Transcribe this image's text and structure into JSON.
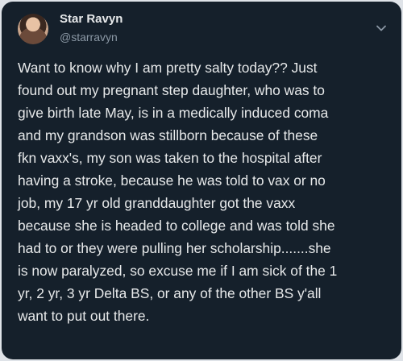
{
  "author": {
    "display_name": "Star Ravyn",
    "handle": "@starravyn",
    "avatar_icon": "profile-photo"
  },
  "menu": {
    "icon": "chevron-down-icon"
  },
  "tweet": {
    "lines": [
      "Want to know why I am pretty salty today?? Just",
      "found out my pregnant step daughter, who was to",
      "give birth late May, is in a medically induced coma",
      "and my grandson was stillborn because of these",
      "fkn vaxx's, my son was taken to the hospital after",
      "having a stroke, because he was told to vax or no",
      "job, my 17 yr old granddaughter got the vaxx",
      "because she is headed to college and was told she",
      "had to or they were pulling her scholarship.......she",
      "is now paralyzed, so excuse me if I am sick of the 1",
      "yr, 2 yr, 3 yr Delta BS, or any of the other BS y'all",
      "want to put out there."
    ]
  },
  "colors": {
    "card_background": "#15202b",
    "primary_text": "#e7e9ea",
    "secondary_text": "#8b98a5"
  }
}
